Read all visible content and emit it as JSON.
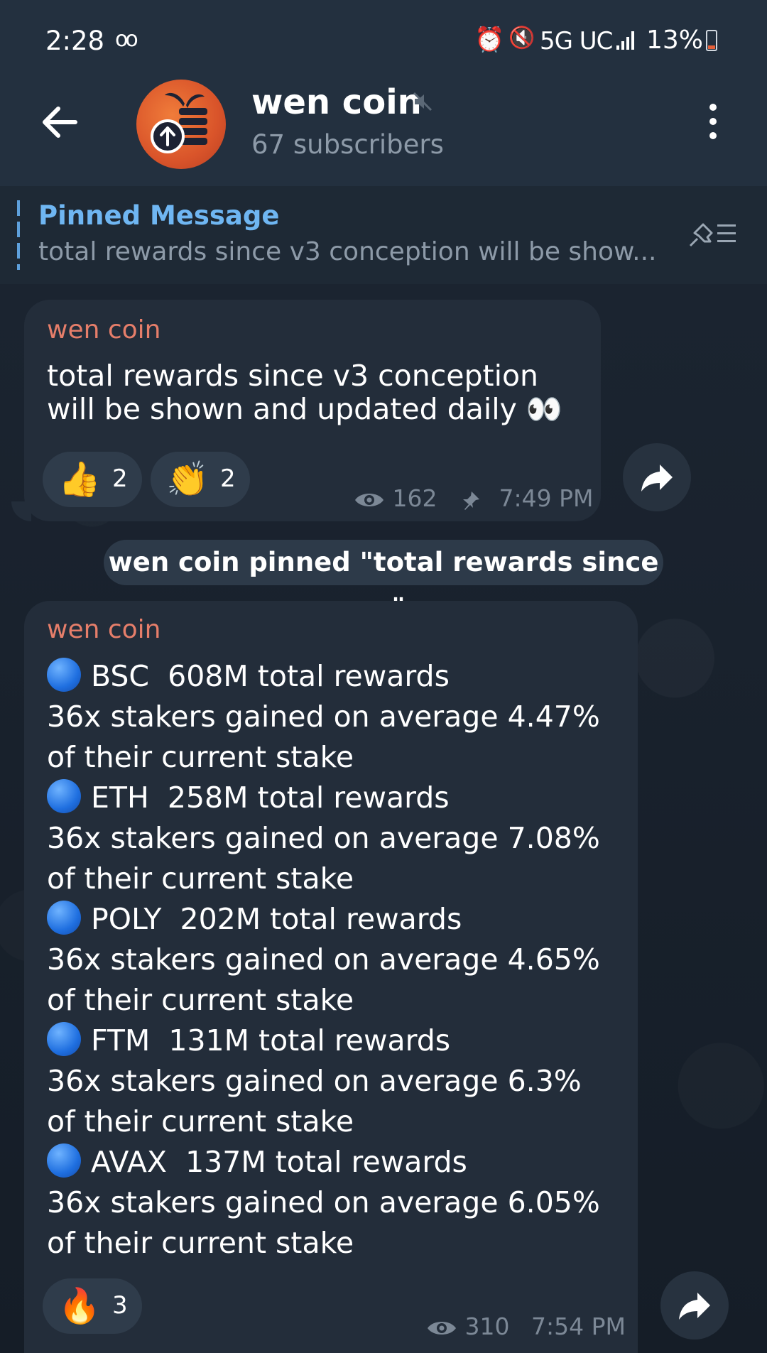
{
  "status_bar": {
    "time": "2:28",
    "voicemail_icon": "oo",
    "alarm_icon": "⏰",
    "mute_icon": "🔇",
    "network": "5G UC",
    "battery": "13%"
  },
  "header": {
    "channel_name": "wen coin",
    "subscribers": "67 subscribers"
  },
  "pinned": {
    "title": "Pinned Message",
    "text": "total rewards since v3 conception will be show..."
  },
  "messages": [
    {
      "sender": "wen coin",
      "lines": [
        "total rewards since v3 conception",
        "will be shown and updated daily 👀"
      ],
      "reactions": [
        {
          "emoji": "👍",
          "count": "2"
        },
        {
          "emoji": "👏",
          "count": "2"
        }
      ],
      "views": "162",
      "time": "7:49 PM"
    },
    {
      "sender": "wen coin",
      "chains": [
        {
          "name": "BSC",
          "amount": "608M total rewards",
          "line2": "36x stakers gained on average 4.47%",
          "line3": "of their current stake"
        },
        {
          "name": "ETH",
          "amount": "258M total rewards",
          "line2": "36x stakers gained on average 7.08%",
          "line3": "of their current stake"
        },
        {
          "name": "POLY",
          "amount": "202M total rewards",
          "line2": "36x stakers gained on average 4.65%",
          "line3": "of their current stake"
        },
        {
          "name": "FTM",
          "amount": "131M total rewards",
          "line2": "36x stakers gained on average 6.3%",
          "line3": "of their current stake"
        },
        {
          "name": "AVAX",
          "amount": "137M total rewards",
          "line2": "36x stakers gained on average 6.05%",
          "line3": "of their current stake"
        }
      ],
      "reactions": [
        {
          "emoji": "🔥",
          "count": "3"
        }
      ],
      "views": "310",
      "time": "7:54 PM"
    }
  ],
  "service_message": "wen coin pinned \"total rewards since ...\""
}
